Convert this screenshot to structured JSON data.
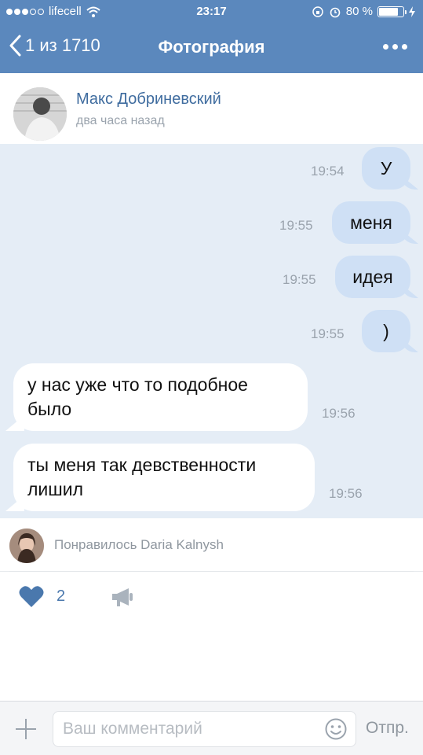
{
  "status_bar": {
    "carrier": "lifecell",
    "time": "23:17",
    "battery_text": "80 %",
    "battery_level": 0.8
  },
  "nav": {
    "back_label": "1 из 1710",
    "title": "Фотография",
    "more_icon": "more-dots-icon"
  },
  "post": {
    "author": "Макс Добриневский",
    "time_ago": "два часа назад"
  },
  "chat": {
    "messages": [
      {
        "text": "У",
        "time": "19:54",
        "direction": "outgoing"
      },
      {
        "text": "меня",
        "time": "19:55",
        "direction": "outgoing"
      },
      {
        "text": "идея",
        "time": "19:55",
        "direction": "outgoing"
      },
      {
        "text": ")",
        "time": "19:55",
        "direction": "outgoing"
      },
      {
        "text": "у нас уже что то подобное было",
        "time": "19:56",
        "direction": "incoming"
      },
      {
        "text": "ты меня так девственности лишил",
        "time": "19:56",
        "direction": "incoming"
      }
    ]
  },
  "likes": {
    "liked_text": "Понравилось Daria Kalnysh",
    "count": "2"
  },
  "comment": {
    "placeholder": "Ваш комментарий",
    "send_label": "Отпр."
  },
  "colors": {
    "header_bg": "#5b88bd",
    "accent_text": "#3f6c9f",
    "out_bubble": "#cfe0f5",
    "photo_bg": "#e5edf6",
    "like_heart": "#4a78ad"
  }
}
